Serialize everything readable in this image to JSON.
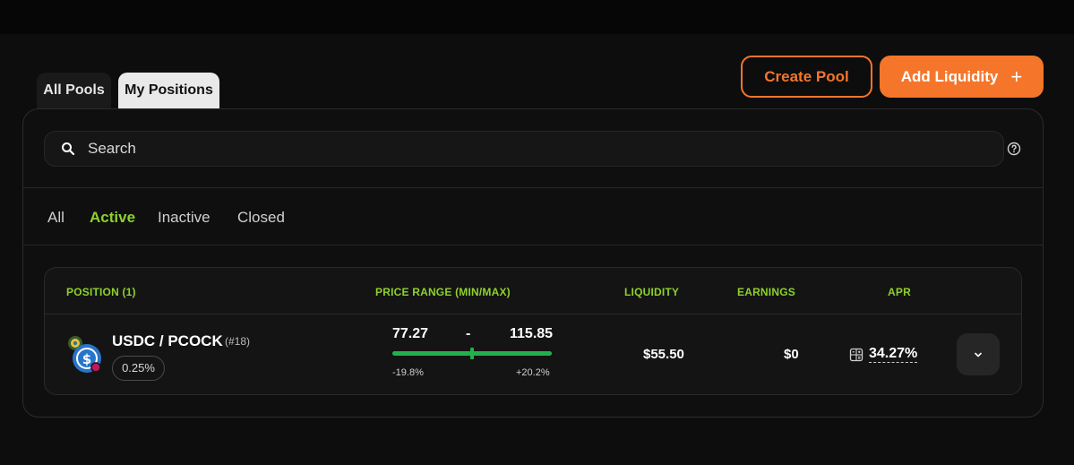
{
  "tabs": [
    {
      "label": "All Pools",
      "active": false
    },
    {
      "label": "My Positions",
      "active": true
    }
  ],
  "actions": {
    "create_pool_label": "Create Pool",
    "add_liquidity_label": "Add Liquidity",
    "add_icon": "+"
  },
  "search": {
    "placeholder": "Search",
    "value": ""
  },
  "filters": [
    {
      "label": "All",
      "active": false
    },
    {
      "label": "Active",
      "active": true
    },
    {
      "label": "Inactive",
      "active": false
    },
    {
      "label": "Closed",
      "active": false
    }
  ],
  "table": {
    "headers": {
      "position": "POSITION (1)",
      "price_range": "PRICE RANGE (MIN/MAX)",
      "liquidity": "LIQUIDITY",
      "earnings": "EARNINGS",
      "apr": "APR"
    },
    "rows": [
      {
        "pair": "USDC / PCOCK",
        "position_id": "(#18)",
        "fee": "0.25%",
        "price_min": "77.27",
        "separator": "-",
        "price_max": "115.85",
        "pct_min": "-19.8%",
        "pct_max": "+20.2%",
        "current_price_position": 0.5,
        "liquidity": "$55.50",
        "earnings": "$0",
        "apr": "34.27%"
      }
    ]
  },
  "colors": {
    "accent_orange": "#f5762a",
    "accent_green": "#8ed12b",
    "range_green": "#22b14c",
    "background": "#0d0d0d"
  },
  "icons": {
    "search": "search-icon",
    "help": "help-circle-icon",
    "calculator": "calculator-icon",
    "chevron": "chevron-down-icon",
    "token_a": "usdc-icon",
    "token_b": "pcock-icon"
  }
}
